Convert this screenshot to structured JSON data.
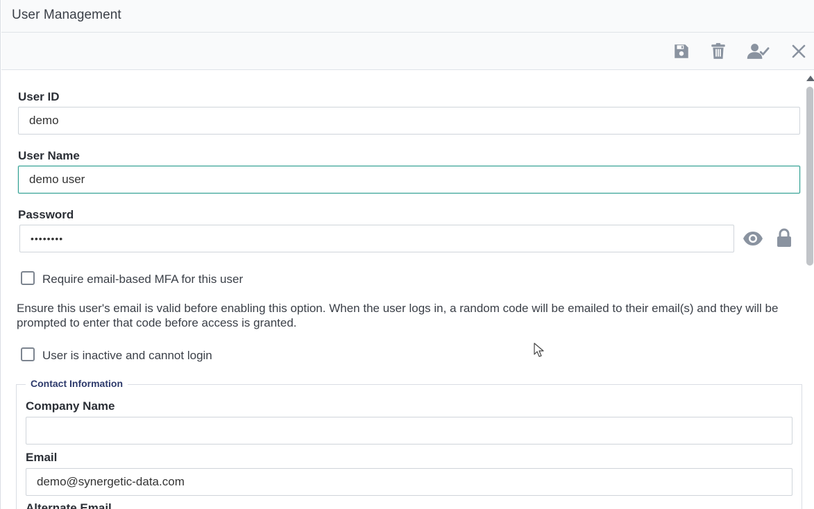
{
  "window": {
    "title": "User Management"
  },
  "toolbar": {
    "icons": [
      "save-icon",
      "trash-icon",
      "user-check-icon",
      "close-icon"
    ],
    "icon_color": "#8a93a0"
  },
  "form": {
    "user_id": {
      "label": "User ID",
      "value": "demo"
    },
    "user_name": {
      "label": "User Name",
      "value": "demo user"
    },
    "password": {
      "label": "Password",
      "value": "••••••••"
    },
    "mfa_checkbox": {
      "label": "Require email-based MFA for this user",
      "checked": false
    },
    "mfa_help": "Ensure this user's email is valid before enabling this option. When the user logs in, a random code will be emailed to their email(s) and they will be prompted to enter that code before access is granted.",
    "inactive_checkbox": {
      "label": "User is inactive and cannot login",
      "checked": false
    }
  },
  "contact": {
    "legend": "Contact Information",
    "company_name": {
      "label": "Company Name",
      "value": ""
    },
    "email": {
      "label": "Email",
      "value": "demo@synergetic-data.com"
    },
    "alternate_email": {
      "label": "Alternate Email"
    }
  },
  "colors": {
    "focus_border": "#2a9d8f",
    "legend_text": "#2d3a6b",
    "icon_gray": "#8a93a0"
  }
}
